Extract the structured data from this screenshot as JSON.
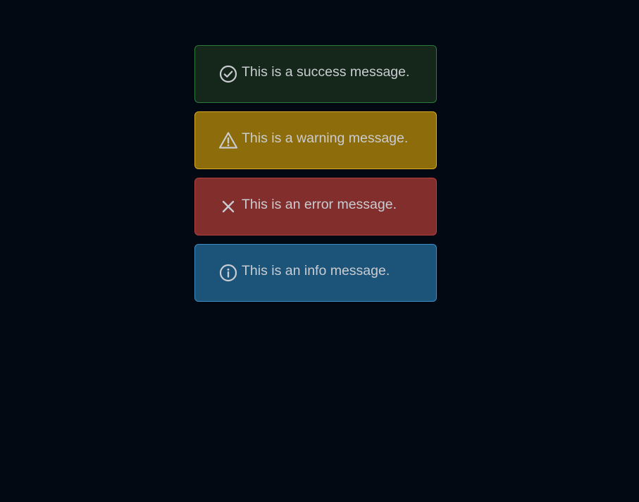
{
  "alerts": [
    {
      "type": "success",
      "icon": "check-circle-icon",
      "message": "This is a success message.",
      "background": "#15261b",
      "border": "#2b7a3b"
    },
    {
      "type": "warning",
      "icon": "warning-triangle-icon",
      "message": "This is a warning message.",
      "background": "#8d6c0b",
      "border": "#d7a923"
    },
    {
      "type": "error",
      "icon": "close-x-icon",
      "message": "This is an error message.",
      "background": "#822e2d",
      "border": "#b44140"
    },
    {
      "type": "info",
      "icon": "info-circle-icon",
      "message": "This is an info message.",
      "background": "#1c5378",
      "border": "#3b8dc4"
    }
  ],
  "colors": {
    "page_background": "#020912",
    "text": "#c9ccd1"
  }
}
